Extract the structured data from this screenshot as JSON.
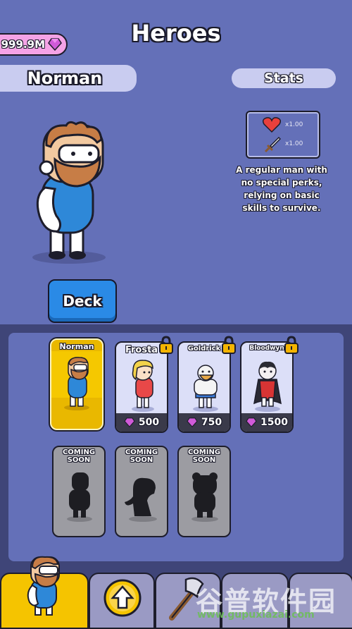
{
  "header": {
    "title": "Heroes",
    "currency": "999.9M"
  },
  "hero": {
    "name": "Norman",
    "stats_label": "Stats",
    "health": "x1.00",
    "attack": "x1.00",
    "description": "A regular man with no special perks, relying on basic skills to survive.",
    "deck_label": "Deck"
  },
  "cards": [
    {
      "name": "Norman",
      "selected": true
    },
    {
      "name": "Frosta",
      "price": "500",
      "locked": true
    },
    {
      "name": "Goldrick",
      "price": "750",
      "locked": true
    },
    {
      "name": "Bloodwyn",
      "price": "1500",
      "locked": true
    }
  ],
  "coming": [
    {
      "label": "COMING SOON"
    },
    {
      "label": "COMING SOON"
    },
    {
      "label": "COMING SOON"
    }
  ],
  "watermark": {
    "text": "谷普软件园",
    "url": "www.gupuxiazai.com"
  },
  "colors": {
    "background": "#6470b8",
    "panel": "#3f4578",
    "accent_gold": "#e9b800",
    "gem": "#c84fd0",
    "deck_button": "#2a8ae6"
  }
}
